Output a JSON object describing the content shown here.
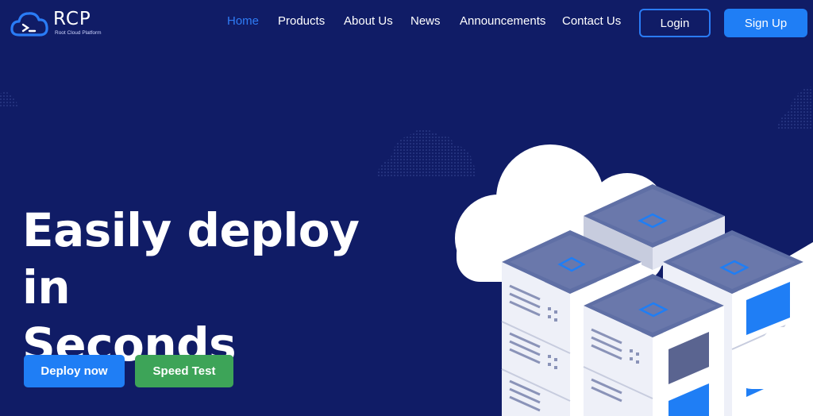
{
  "brand": {
    "name": "RCP",
    "tagline": "Root Cloud Platform",
    "accent": "#1f7ef5",
    "background": "#101c66",
    "success": "#3da458"
  },
  "nav": {
    "items": [
      {
        "label": "Home",
        "active": true
      },
      {
        "label": "Products",
        "active": false
      },
      {
        "label": "About Us",
        "active": false
      },
      {
        "label": "News",
        "active": false
      },
      {
        "label": "Announcements",
        "active": false
      },
      {
        "label": "Contact Us",
        "active": false
      }
    ],
    "login_label": "Login",
    "signup_label": "Sign Up"
  },
  "hero": {
    "title_line1": "Easily deploy in",
    "title_line2": "Seconds",
    "deploy_label": "Deploy now",
    "speed_label": "Speed Test"
  }
}
